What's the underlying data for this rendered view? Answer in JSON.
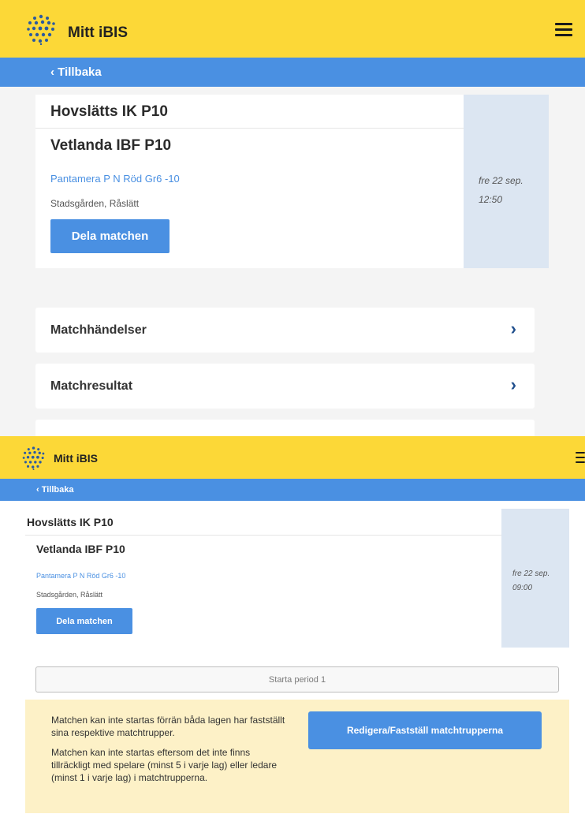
{
  "screen1": {
    "header": {
      "app_title": "Mitt iBIS",
      "logo_icon": "ibis-dots-logo",
      "menu_icon": "hamburger-menu-icon"
    },
    "back": {
      "label": "‹ Tillbaka"
    },
    "match": {
      "home_team": "Hovslätts IK P10",
      "away_team": "Vetlanda IBF P10",
      "series": "Pantamera P N Röd Gr6 -10",
      "venue": "Stadsgården, Råslätt",
      "share_label": "Dela matchen",
      "date": "fre 22 sep.",
      "time": "12:50"
    },
    "nav_items": [
      {
        "label": "Matchhändelser",
        "chevron": "›"
      },
      {
        "label": "Matchresultat",
        "chevron": "›"
      }
    ]
  },
  "screen2": {
    "header": {
      "app_title": "Mitt iBIS",
      "logo_icon": "ibis-dots-logo",
      "menu_icon": "hamburger-menu-icon"
    },
    "back": {
      "label": "‹ Tillbaka"
    },
    "match": {
      "home_team": "Hovslätts IK P10",
      "away_team": "Vetlanda IBF P10",
      "series": "Pantamera P N Röd Gr6 -10",
      "venue": "Stadsgården, Råslätt",
      "share_label": "Dela matchen",
      "date": "fre 22 sep.",
      "time": "09:00"
    },
    "period_label": "Starta period 1",
    "warnings": [
      "Matchen kan inte startas förrän båda lagen har fastställt sina respektive matchtrupper.",
      "Matchen kan inte startas eftersom det inte finns tillräckligt med spelare (minst 5 i varje lag) eller ledare (minst 1 i varje lag) i matchtrupperna."
    ],
    "edit_label": "Redigera/Fastställ matchtrupperna"
  },
  "colors": {
    "header": "#fcd837",
    "accent": "#4a90e2",
    "date_panel": "#dce6f2",
    "warning_bg": "#fdf1c7"
  }
}
